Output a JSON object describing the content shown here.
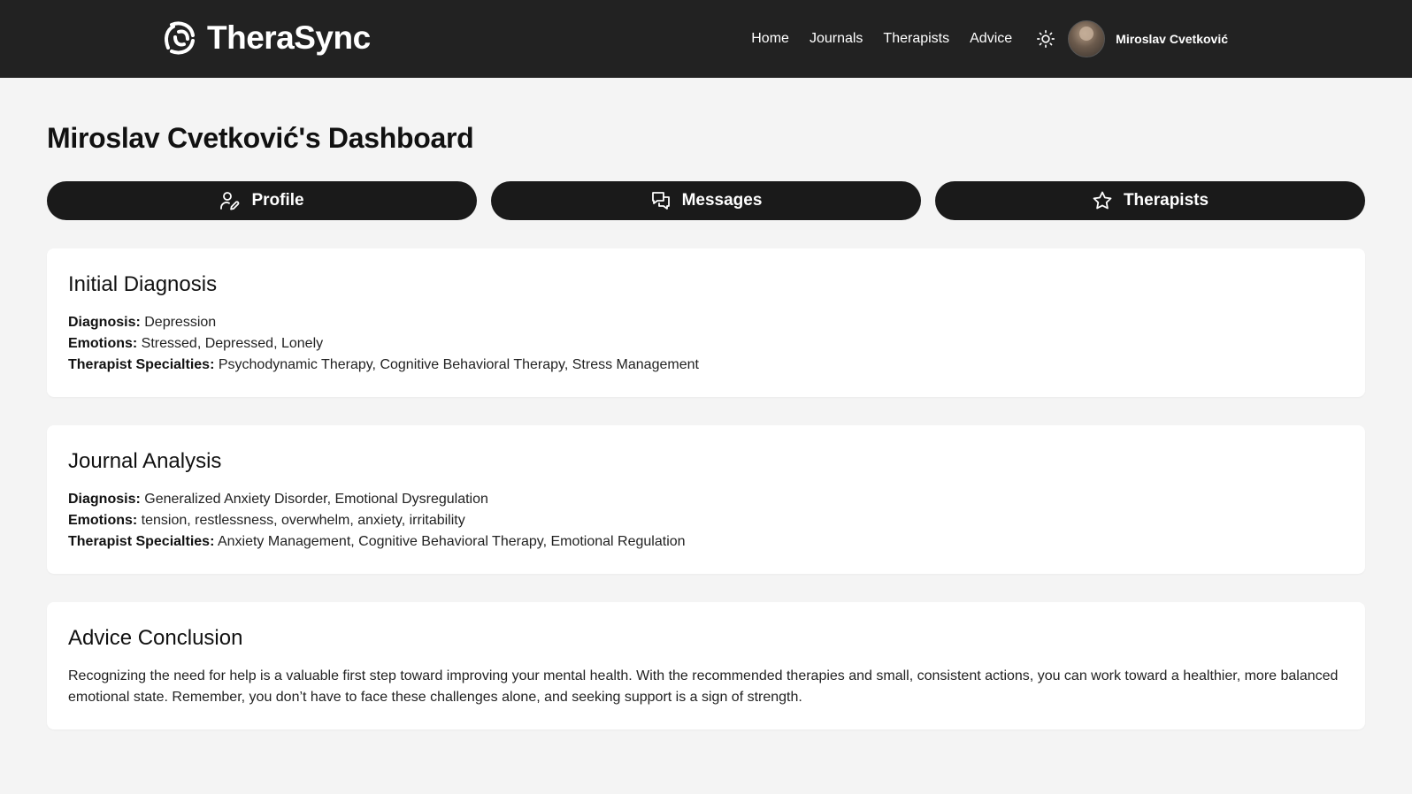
{
  "header": {
    "brand": "TheraSync",
    "nav": [
      "Home",
      "Journals",
      "Therapists",
      "Advice"
    ],
    "user_name": "Miroslav Cvetković"
  },
  "page": {
    "title": "Miroslav Cvetković's Dashboard"
  },
  "tabs": [
    {
      "label": "Profile",
      "icon": "user-pen-icon"
    },
    {
      "label": "Messages",
      "icon": "messages-icon"
    },
    {
      "label": "Therapists",
      "icon": "star-icon"
    }
  ],
  "initial_diagnosis": {
    "title": "Initial Diagnosis",
    "diagnosis_label": "Diagnosis:",
    "diagnosis": "Depression",
    "emotions_label": "Emotions:",
    "emotions": "Stressed, Depressed, Lonely",
    "specialties_label": "Therapist Specialties:",
    "specialties": "Psychodynamic Therapy, Cognitive Behavioral Therapy, Stress Management"
  },
  "journal_analysis": {
    "title": "Journal Analysis",
    "diagnosis_label": "Diagnosis:",
    "diagnosis": "Generalized Anxiety Disorder, Emotional Dysregulation",
    "emotions_label": "Emotions:",
    "emotions": "tension, restlessness, overwhelm, anxiety, irritability",
    "specialties_label": "Therapist Specialties:",
    "specialties": "Anxiety Management, Cognitive Behavioral Therapy, Emotional Regulation"
  },
  "advice_conclusion": {
    "title": "Advice Conclusion",
    "text": "Recognizing the need for help is a valuable first step toward improving your mental health. With the recommended therapies and small, consistent actions, you can work toward a healthier, more balanced emotional state. Remember, you don’t have to face these challenges alone, and seeking support is a sign of strength."
  },
  "colors": {
    "navbar": "#222222",
    "page_bg": "#f4f4f4",
    "tab_bg": "#1a1a1a",
    "card_bg": "#ffffff"
  }
}
